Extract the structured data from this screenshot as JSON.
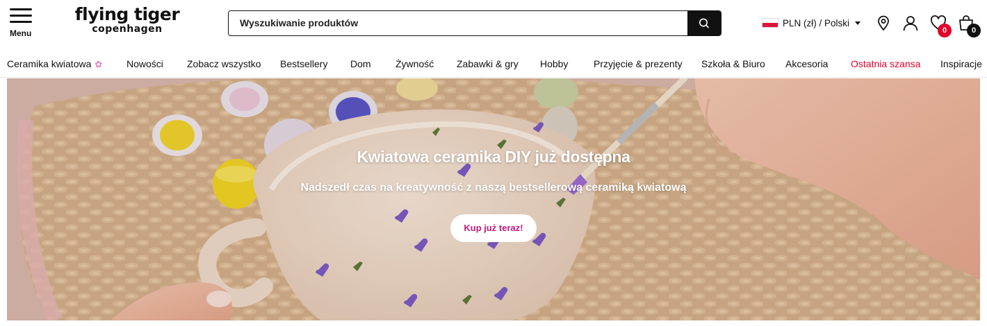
{
  "header": {
    "menu_label": "Menu",
    "logo_line1": "flying tiger",
    "logo_line2": "copenhagen",
    "search_placeholder": "Wyszukiwanie produktów",
    "locale_label": "PLN (zł) / Polski",
    "wishlist_count": "0",
    "cart_count": "0",
    "badge_color": "#e4002b"
  },
  "nav": {
    "items": [
      "Ceramika kwiatowa",
      "Nowości",
      "Zobacz wszystko",
      "Bestsellery",
      "Dom",
      "Żywność",
      "Zabawki & gry",
      "Hobby",
      "Przyjęcie & prezenty",
      "Szkoła & Biuro",
      "Akcesoria",
      "Ostatnia szansa",
      "Inspiracje"
    ],
    "flower_icon": "✿",
    "sale_color": "#e4002b"
  },
  "hero": {
    "title": "Kwiatowa ceramika DIY już dostępna",
    "subtitle": "Nadszedł czas na kreatywność z naszą bestsellerową ceramiką kwiatową",
    "cta_label": "Kup już teraz!",
    "cta_color": "#c2187a"
  },
  "icons": {
    "menu": "hamburger-icon",
    "search": "magnifier-icon",
    "location": "map-pin-icon",
    "account": "user-icon",
    "wishlist": "heart-icon",
    "cart": "shopping-bag-icon"
  }
}
